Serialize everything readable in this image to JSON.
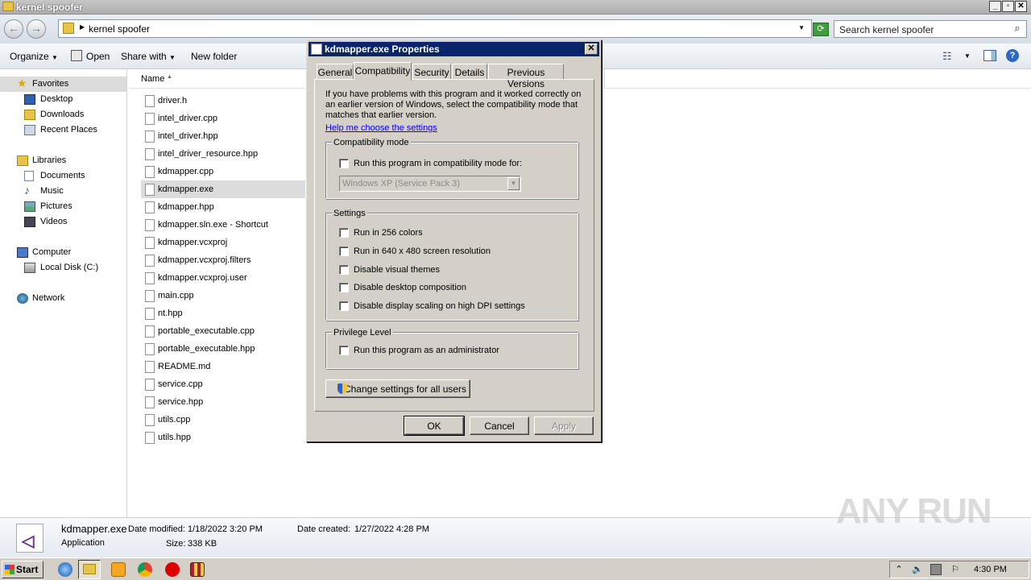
{
  "window": {
    "title": "kernel spoofer"
  },
  "address": {
    "path": "kernel spoofer",
    "search_placeholder": "Search kernel spoofer"
  },
  "toolbar": {
    "organize": "Organize",
    "open": "Open",
    "share_with": "Share with",
    "new_folder": "New folder"
  },
  "nav": {
    "favorites": "Favorites",
    "desktop": "Desktop",
    "downloads": "Downloads",
    "recent_places": "Recent Places",
    "libraries": "Libraries",
    "documents": "Documents",
    "music": "Music",
    "pictures": "Pictures",
    "videos": "Videos",
    "computer": "Computer",
    "local_disk": "Local Disk (C:)",
    "network": "Network"
  },
  "list": {
    "column_name": "Name",
    "files": [
      "driver.h",
      "intel_driver.cpp",
      "intel_driver.hpp",
      "intel_driver_resource.hpp",
      "kdmapper.cpp",
      "kdmapper.exe",
      "kdmapper.hpp",
      "kdmapper.sln.exe - Shortcut",
      "kdmapper.vcxproj",
      "kdmapper.vcxproj.filters",
      "kdmapper.vcxproj.user",
      "main.cpp",
      "nt.hpp",
      "portable_executable.cpp",
      "portable_executable.hpp",
      "README.md",
      "service.cpp",
      "service.hpp",
      "utils.cpp",
      "utils.hpp"
    ],
    "selected": "kdmapper.exe"
  },
  "details": {
    "name": "kdmapper.exe",
    "type": "Application",
    "modified_label": "Date modified:",
    "modified": "1/18/2022 3:20 PM",
    "created_label": "Date created:",
    "created": "1/27/2022 4:28 PM",
    "size_label": "Size:",
    "size": "338 KB"
  },
  "dialog": {
    "title": "kdmapper.exe Properties",
    "tabs": [
      "General",
      "Compatibility",
      "Security",
      "Details",
      "Previous Versions"
    ],
    "active_tab": "Compatibility",
    "intro": "If you have problems with this program and it worked correctly on an earlier version of Windows, select the compatibility mode that matches that earlier version.",
    "help_link": "Help me choose the settings",
    "compat_group": "Compatibility mode",
    "compat_check": "Run this program in compatibility mode for:",
    "compat_value": "Windows XP (Service Pack 3)",
    "settings_group": "Settings",
    "settings": [
      "Run in 256 colors",
      "Run in 640 x 480 screen resolution",
      "Disable visual themes",
      "Disable desktop composition",
      "Disable display scaling on high DPI settings"
    ],
    "privilege_group": "Privilege Level",
    "privilege_check": "Run this program as an administrator",
    "change_all": "Change settings for all users",
    "ok": "OK",
    "cancel": "Cancel",
    "apply": "Apply"
  },
  "taskbar": {
    "start": "Start",
    "clock": "4:30 PM"
  },
  "watermark": "ANY RUN"
}
